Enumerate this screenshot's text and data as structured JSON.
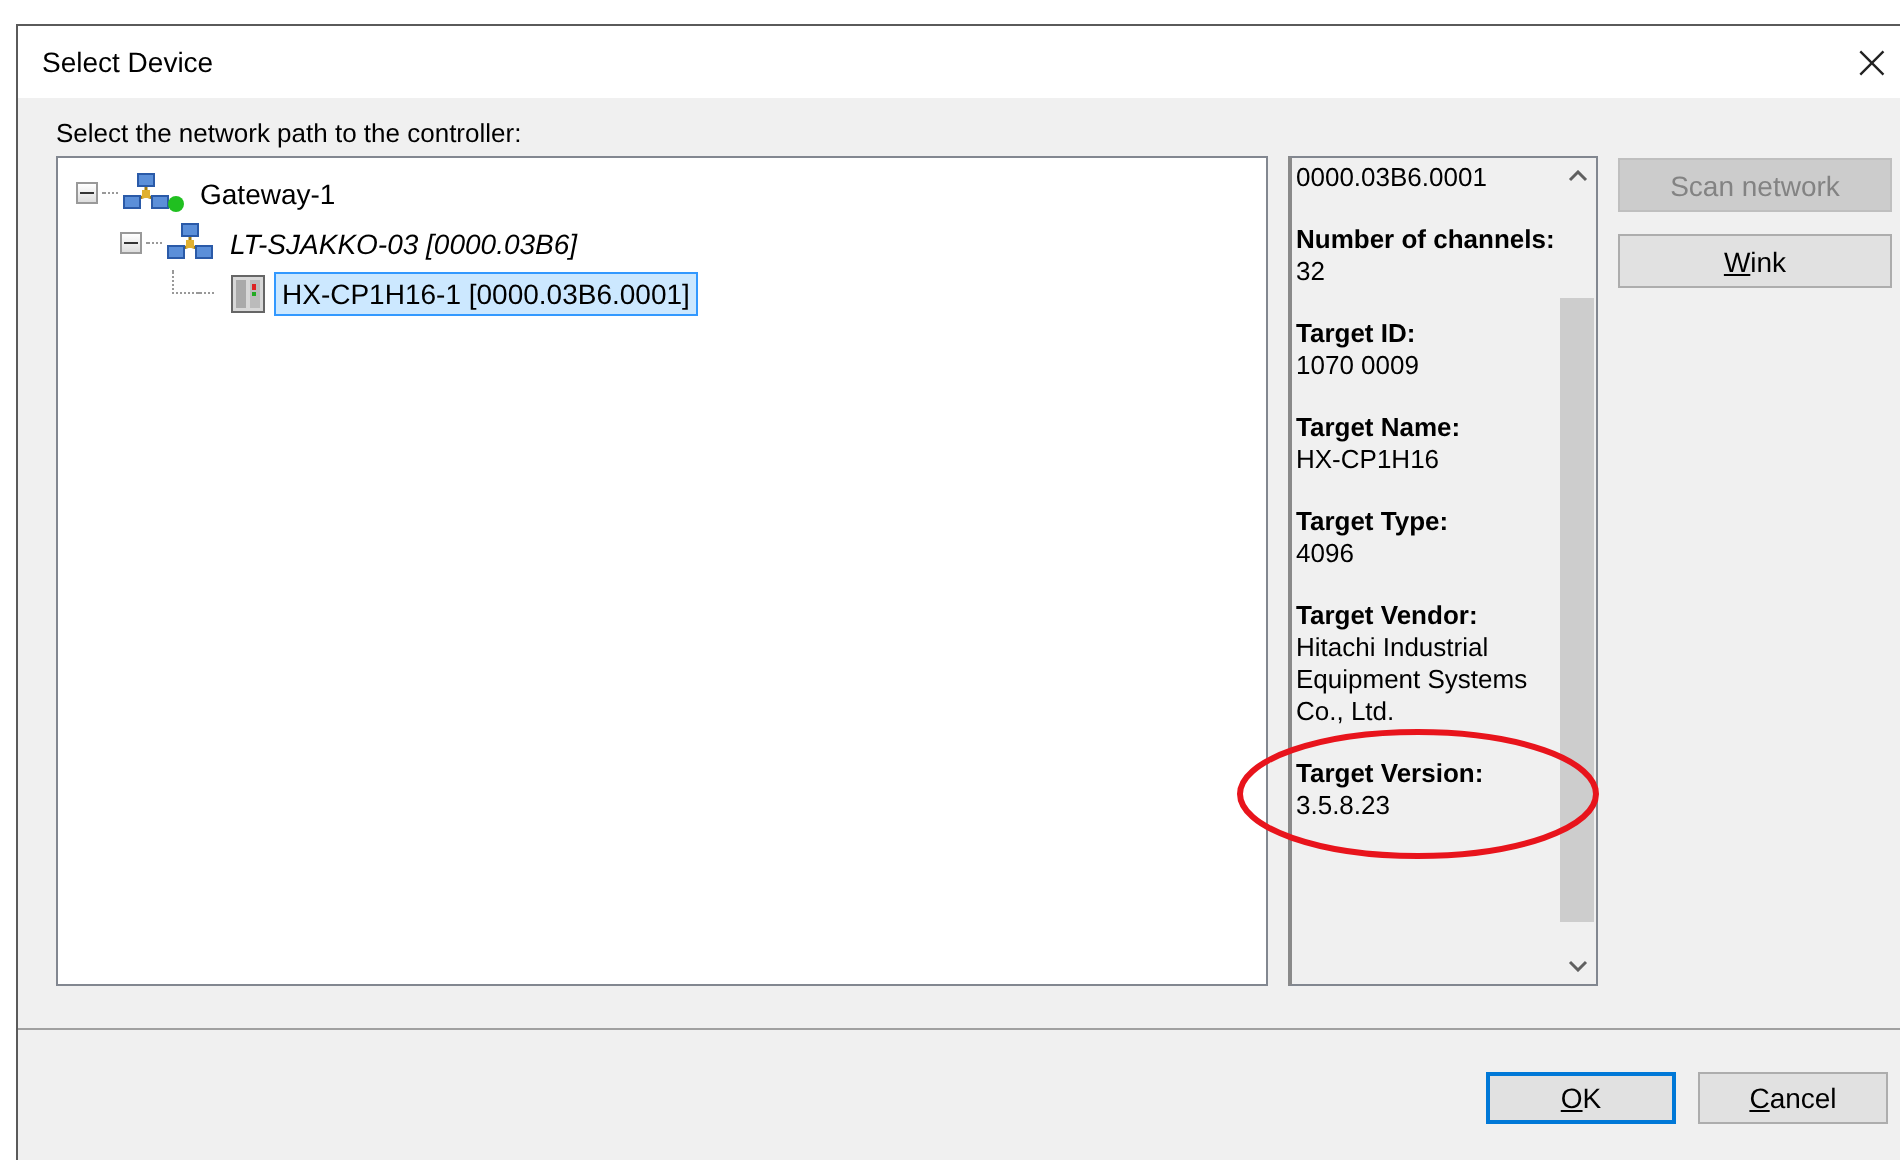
{
  "window": {
    "title": "Select Device",
    "close": "×"
  },
  "prompt": "Select the network path to the controller:",
  "tree": [
    {
      "label": "Gateway-1",
      "kind": "gateway",
      "expanded": true,
      "online": true,
      "selected": false,
      "children": [
        {
          "label": "LT-SJAKKO-03 [0000.03B6]",
          "kind": "adapter",
          "expanded": true,
          "selected": false,
          "children": [
            {
              "label": "HX-CP1H16-1 [0000.03B6.0001]",
              "kind": "controller",
              "selected": true
            }
          ]
        }
      ]
    }
  ],
  "info": [
    {
      "value": "0000.03B6.0001",
      "circled": false
    },
    {
      "label": "Number of channels:",
      "value": "32",
      "circled": false
    },
    {
      "label": "Target ID:",
      "value": "1070 0009",
      "circled": false
    },
    {
      "label": "Target Name:",
      "value": "HX-CP1H16",
      "circled": false
    },
    {
      "label": "Target Type:",
      "value": "4096",
      "circled": false
    },
    {
      "label": "Target Vendor:",
      "value": "Hitachi Industrial Equipment Systems Co., Ltd.",
      "circled": false
    },
    {
      "label": "Target Version:",
      "value": "3.5.8.23",
      "circled": true
    }
  ],
  "side_buttons": [
    {
      "label": "Scan network",
      "disabled": true,
      "underline_first": false
    },
    {
      "label": "Wink",
      "disabled": false,
      "underline_first": true
    }
  ],
  "footer_buttons": [
    {
      "label": "OK",
      "default": true,
      "underline_first": true
    },
    {
      "label": "Cancel",
      "default": false,
      "underline_first": true
    }
  ]
}
